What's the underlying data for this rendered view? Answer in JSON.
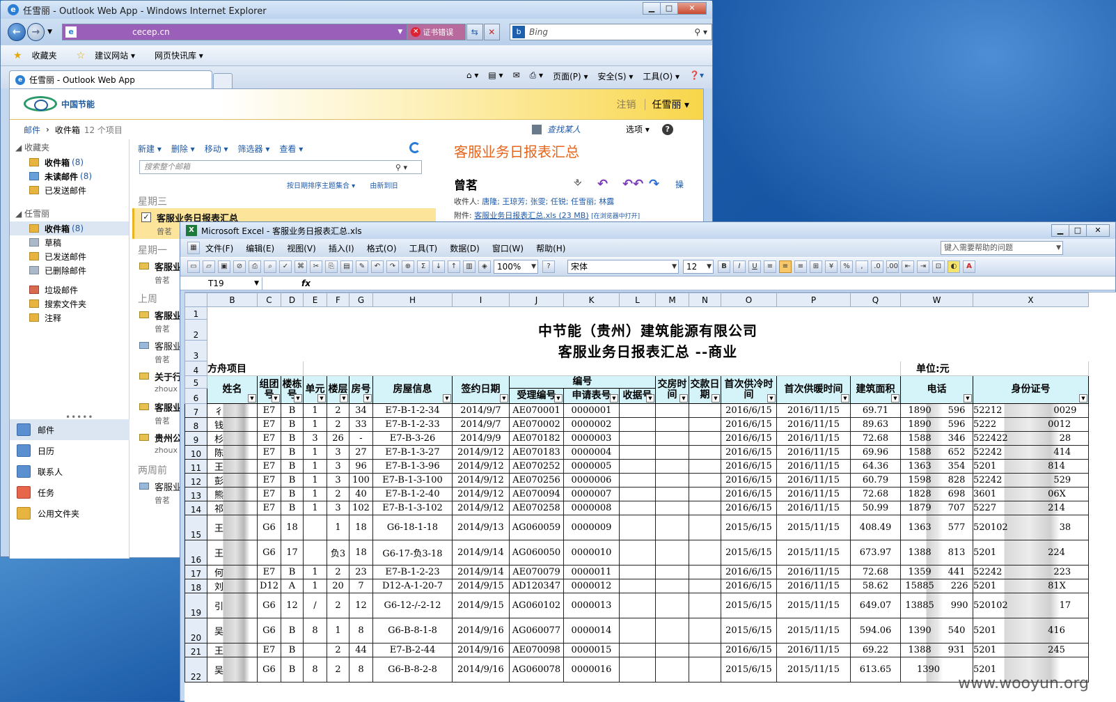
{
  "ie": {
    "title": "任雪丽 - Outlook Web App - Windows Internet Explorer",
    "url": "cecep.cn",
    "cert_error": "证书错误",
    "search_placeholder": "Bing",
    "favorites": [
      "收藏夹",
      "建议网站 ▾",
      "网页快讯库 ▾"
    ],
    "tab_label": "任雪丽 - Outlook Web App",
    "commands": [
      "页面(P) ▾",
      "安全(S) ▾",
      "工具(O) ▾"
    ]
  },
  "owa": {
    "logo_text": "中国节能",
    "signout": "注销",
    "user": "任雪丽 ▾",
    "breadcrumb_root": "邮件",
    "breadcrumb_current": "收件箱",
    "breadcrumb_count": "12 个项目",
    "find_people": "查找某人",
    "options": "选项 ▾",
    "nav": {
      "favorites_header": "◢ 收藏夹",
      "favorites": [
        {
          "label": "收件箱",
          "count": "(8)"
        },
        {
          "label": "未读邮件",
          "count": "(8)"
        },
        {
          "label": "已发送邮件",
          "count": ""
        }
      ],
      "account_header": "◢ 任雪丽",
      "folders": [
        {
          "label": "收件箱",
          "count": "(8)"
        },
        {
          "label": "草稿",
          "count": ""
        },
        {
          "label": "已发送邮件",
          "count": ""
        },
        {
          "label": "已删除邮件",
          "count": ""
        },
        {
          "label": "垃圾邮件",
          "count": ""
        },
        {
          "label": "搜索文件夹",
          "count": ""
        },
        {
          "label": "注释",
          "count": ""
        }
      ],
      "modules": [
        "邮件",
        "日历",
        "联系人",
        "任务",
        "公用文件夹"
      ]
    },
    "list": {
      "toolbar": [
        "新建 ▾",
        "删除 ▾",
        "移动 ▾",
        "筛选器 ▾",
        "查看 ▾"
      ],
      "search_placeholder": "搜索整个邮箱",
      "sort_label": "按日期排序主题集合 ▾",
      "sort_order": "由新到旧",
      "groups": [
        {
          "label": "星期三",
          "messages": [
            {
              "subject": "客服业务日报表汇总",
              "sender": "曾茗"
            }
          ]
        },
        {
          "label": "星期一",
          "messages": [
            {
              "subject": "客服业",
              "sender": "曾茗"
            }
          ]
        },
        {
          "label": "上周",
          "messages": [
            {
              "subject": "客服业",
              "sender": "曾茗"
            },
            {
              "subject": "客服业",
              "sender": "曾茗"
            },
            {
              "subject": "关于行",
              "sender": "zhoux"
            },
            {
              "subject": "客服业",
              "sender": "曾茗"
            },
            {
              "subject": "贵州公",
              "sender": "zhoux"
            }
          ]
        },
        {
          "label": "两周前",
          "messages": [
            {
              "subject": "客服业",
              "sender": "曾茗"
            }
          ]
        }
      ]
    },
    "reading": {
      "subject": "客服业务日报表汇总",
      "from": "曾茗",
      "to_label": "收件人:",
      "to": "唐隆; 王琼芳; 张雯; 任锐; 任雪丽; 林露",
      "attach_label": "附件:",
      "attachment": "客服业务日报表汇总.xls (23 MB)",
      "attach_open": "[在浏览器中打开]",
      "more": "操"
    }
  },
  "excel": {
    "title": "Microsoft Excel - 客服业务日报表汇总.xls",
    "menu": [
      "文件(F)",
      "编辑(E)",
      "视图(V)",
      "插入(I)",
      "格式(O)",
      "工具(T)",
      "数据(D)",
      "窗口(W)",
      "帮助(H)"
    ],
    "help_placeholder": "键入需要帮助的问题",
    "zoom": "100%",
    "font": "宋体",
    "font_size": "12",
    "name_box": "T19",
    "fx": "fx",
    "columns": [
      "B",
      "C",
      "D",
      "E",
      "F",
      "G",
      "H",
      "I",
      "J",
      "K",
      "L",
      "M",
      "N",
      "O",
      "P",
      "Q",
      "W",
      "X"
    ],
    "company": "中节能（贵州）建筑能源有限公司",
    "report_title": "客服业务日报表汇总 --商业",
    "project": "方舟项目",
    "unit": "单位:元",
    "header": {
      "name": "姓名",
      "group": "组团号",
      "building": "楼栋号",
      "unit": "单元",
      "floor": "楼层",
      "room": "房号",
      "house": "房屋信息",
      "sign_date": "签约日期",
      "number": "编号",
      "accept_no": "受理编号",
      "apply_no": "申请表号",
      "receipt": "收据号",
      "handover": "交房时间",
      "pay_date": "交款日期",
      "first_cool": "首次供冷时间",
      "first_heat": "首次供暖时间",
      "area": "建筑面积",
      "phone": "电话",
      "id_no": "身份证号"
    },
    "rows": [
      {
        "r": "7",
        "n": "彳",
        "c": "E7",
        "d": "B",
        "e": "1",
        "f": "2",
        "g": "34",
        "h": "E7-B-1-2-34",
        "i": "2014/9/7",
        "j": "AE070001",
        "k": "0000001",
        "o": "2016/6/15",
        "p": "2016/11/15",
        "q": "69.71",
        "w1": "1890",
        "w2": "596",
        "x1": "52212",
        "x2": "0029",
        "tall": false
      },
      {
        "r": "8",
        "n": "钱",
        "c": "E7",
        "d": "B",
        "e": "1",
        "f": "2",
        "g": "33",
        "h": "E7-B-1-2-33",
        "i": "2014/9/7",
        "j": "AE070002",
        "k": "0000002",
        "o": "2016/6/15",
        "p": "2016/11/15",
        "q": "89.63",
        "w1": "1890",
        "w2": "596",
        "x1": "5222",
        "x2": "0012",
        "tall": false
      },
      {
        "r": "9",
        "n": "杉",
        "c": "E7",
        "d": "B",
        "e": "3",
        "f": "26",
        "g": "-",
        "h": "E7-B-3-26",
        "i": "2014/9/9",
        "j": "AE070182",
        "k": "0000003",
        "o": "2016/6/15",
        "p": "2016/11/15",
        "q": "72.68",
        "w1": "1588",
        "w2": "346",
        "x1": "522422",
        "x2": "28",
        "tall": false
      },
      {
        "r": "10",
        "n": "陈",
        "c": "E7",
        "d": "B",
        "e": "1",
        "f": "3",
        "g": "27",
        "h": "E7-B-1-3-27",
        "i": "2014/9/12",
        "j": "AE070183",
        "k": "0000004",
        "o": "2016/6/15",
        "p": "2016/11/15",
        "q": "69.96",
        "w1": "1588",
        "w2": "652",
        "x1": "52242",
        "x2": "414",
        "tall": false
      },
      {
        "r": "11",
        "n": "王",
        "c": "E7",
        "d": "B",
        "e": "1",
        "f": "3",
        "g": "96",
        "h": "E7-B-1-3-96",
        "i": "2014/9/12",
        "j": "AE070252",
        "k": "0000005",
        "o": "2016/6/15",
        "p": "2016/11/15",
        "q": "64.36",
        "w1": "1363",
        "w2": "354",
        "x1": "5201",
        "x2": "814",
        "tall": false
      },
      {
        "r": "12",
        "n": "彭",
        "c": "E7",
        "d": "B",
        "e": "1",
        "f": "3",
        "g": "100",
        "h": "E7-B-1-3-100",
        "i": "2014/9/12",
        "j": "AE070256",
        "k": "0000006",
        "o": "2016/6/15",
        "p": "2016/11/15",
        "q": "60.79",
        "w1": "1598",
        "w2": "828",
        "x1": "52242",
        "x2": "529",
        "tall": false
      },
      {
        "r": "13",
        "n": "熊",
        "c": "E7",
        "d": "B",
        "e": "1",
        "f": "2",
        "g": "40",
        "h": "E7-B-1-2-40",
        "i": "2014/9/12",
        "j": "AE070094",
        "k": "0000007",
        "o": "2016/6/15",
        "p": "2016/11/15",
        "q": "72.68",
        "w1": "1828",
        "w2": "698",
        "x1": "3601",
        "x2": "06X",
        "tall": false
      },
      {
        "r": "14",
        "n": "祁",
        "c": "E7",
        "d": "B",
        "e": "1",
        "f": "3",
        "g": "102",
        "h": "E7-B-1-3-102",
        "i": "2014/9/12",
        "j": "AE070258",
        "k": "0000008",
        "o": "2016/6/15",
        "p": "2016/11/15",
        "q": "50.99",
        "w1": "1879",
        "w2": "707",
        "x1": "5227",
        "x2": "214",
        "tall": false
      },
      {
        "r": "15",
        "n": "王",
        "c": "G6",
        "d": "18",
        "e": "",
        "f": "1",
        "g": "18",
        "h": "G6-18-1-18",
        "i": "2014/9/13",
        "j": "AG060059",
        "k": "0000009",
        "o": "2015/6/15",
        "p": "2015/11/15",
        "q": "408.49",
        "w1": "1363",
        "w2": "577",
        "x1": "520102",
        "x2": "38",
        "tall": true
      },
      {
        "r": "16",
        "n": "王",
        "c": "G6",
        "d": "17",
        "e": "",
        "f": "负3",
        "g": "18",
        "h": "G6-17-负3-18",
        "i": "2014/9/14",
        "j": "AG060050",
        "k": "0000010",
        "o": "2015/6/15",
        "p": "2015/11/15",
        "q": "673.97",
        "w1": "1388",
        "w2": "813",
        "x1": "5201",
        "x2": "224",
        "tall": true
      },
      {
        "r": "17",
        "n": "何",
        "c": "E7",
        "d": "B",
        "e": "1",
        "f": "2",
        "g": "23",
        "h": "E7-B-1-2-23",
        "i": "2014/9/14",
        "j": "AE070079",
        "k": "0000011",
        "o": "2016/6/15",
        "p": "2016/11/15",
        "q": "72.68",
        "w1": "1359",
        "w2": "441",
        "x1": "52242",
        "x2": "223",
        "tall": false
      },
      {
        "r": "18",
        "n": "刘",
        "c": "D12",
        "d": "A",
        "e": "1",
        "f": "20",
        "g": "7",
        "h": "D12-A-1-20-7",
        "i": "2014/9/15",
        "j": "AD120347",
        "k": "0000012",
        "o": "2016/6/15",
        "p": "2016/11/15",
        "q": "58.62",
        "w1": "15885",
        "w2": "226",
        "x1": "5201",
        "x2": "81X",
        "tall": false
      },
      {
        "r": "19",
        "n": "引",
        "c": "G6",
        "d": "12",
        "e": "/",
        "f": "2",
        "g": "12",
        "h": "G6-12-/-2-12",
        "i": "2014/9/15",
        "j": "AG060102",
        "k": "0000013",
        "o": "2015/6/15",
        "p": "2015/11/15",
        "q": "649.07",
        "w1": "13885",
        "w2": "990",
        "x1": "520102",
        "x2": "17",
        "tall": true
      },
      {
        "r": "20",
        "n": "吴",
        "c": "G6",
        "d": "B",
        "e": "8",
        "f": "1",
        "g": "8",
        "h": "G6-B-8-1-8",
        "i": "2014/9/16",
        "j": "AG060077",
        "k": "0000014",
        "o": "2015/6/15",
        "p": "2015/11/15",
        "q": "594.06",
        "w1": "1390",
        "w2": "540",
        "x1": "5201",
        "x2": "416",
        "tall": true
      },
      {
        "r": "21",
        "n": "王",
        "c": "E7",
        "d": "B",
        "e": "",
        "f": "2",
        "g": "44",
        "h": "E7-B-2-44",
        "i": "2014/9/16",
        "j": "AE070098",
        "k": "0000015",
        "o": "2016/6/15",
        "p": "2016/11/15",
        "q": "69.22",
        "w1": "1388",
        "w2": "931",
        "x1": "5201",
        "x2": "245",
        "tall": false
      },
      {
        "r": "22",
        "n": "吴",
        "c": "G6",
        "d": "B",
        "e": "8",
        "f": "2",
        "g": "8",
        "h": "G6-B-8-2-8",
        "i": "2014/9/16",
        "j": "AG060078",
        "k": "0000016",
        "o": "2015/6/15",
        "p": "2015/11/15",
        "q": "613.65",
        "w1": "1390",
        "w2": "",
        "x1": "5201",
        "x2": "",
        "tall": true
      }
    ],
    "watermark": "www.wooyun.org"
  }
}
